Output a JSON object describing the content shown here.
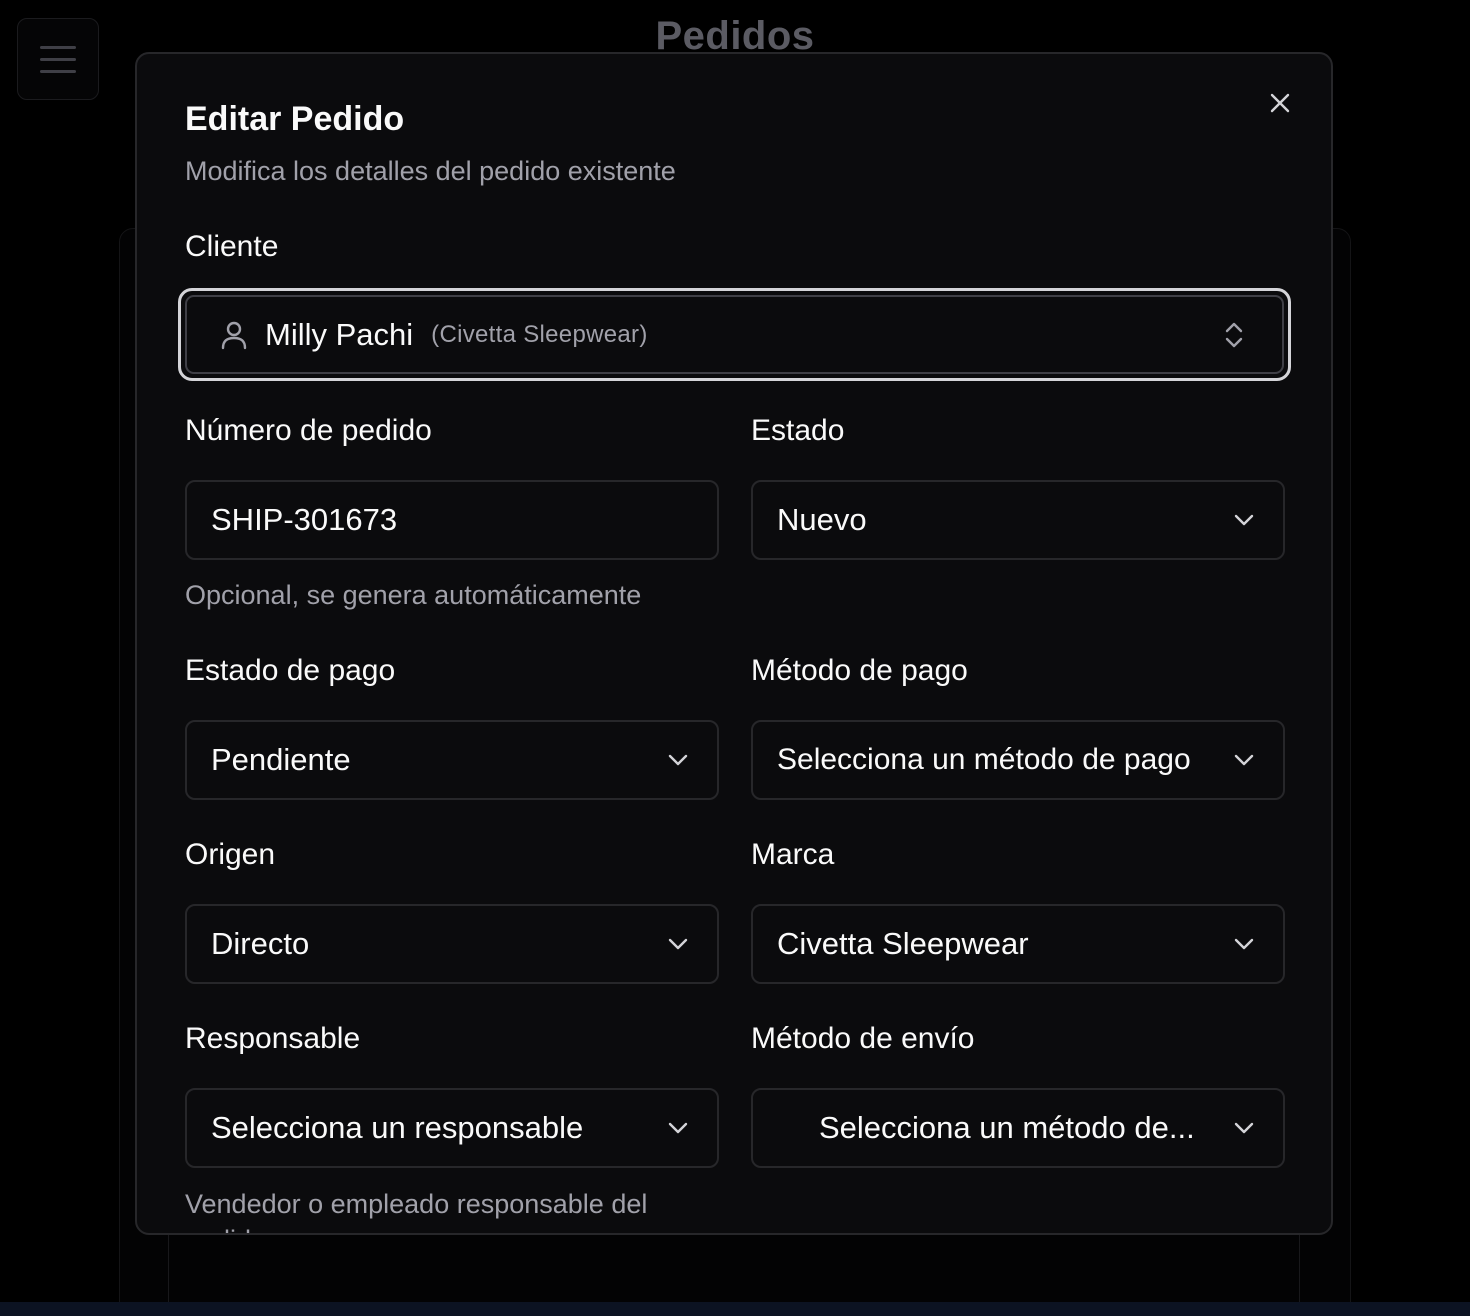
{
  "background": {
    "page_title": "Pedidos"
  },
  "modal": {
    "title": "Editar Pedido",
    "description": "Modifica los detalles del pedido existente",
    "close_icon": "close-icon",
    "cliente": {
      "label": "Cliente",
      "name": "Milly Pachi",
      "brand": "(Civetta Sleepwear)",
      "icon": "user-icon"
    },
    "numero_pedido": {
      "label": "Número de pedido",
      "value": "SHIP-301673",
      "hint": "Opcional, se genera automáticamente"
    },
    "estado": {
      "label": "Estado",
      "value": "Nuevo"
    },
    "estado_pago": {
      "label": "Estado de pago",
      "value": "Pendiente"
    },
    "metodo_pago": {
      "label": "Método de pago",
      "value": "Selecciona un método de pago"
    },
    "origen": {
      "label": "Origen",
      "value": "Directo"
    },
    "marca": {
      "label": "Marca",
      "value": "Civetta Sleepwear"
    },
    "responsable": {
      "label": "Responsable",
      "value": "Selecciona un responsable",
      "hint": "Vendedor o empleado responsable del pedido"
    },
    "metodo_envio": {
      "label": "Método de envío",
      "value": "Selecciona un método de..."
    }
  },
  "colors": {
    "background": "#000000",
    "modal_bg": "#0b0b0d",
    "border": "#27272a",
    "focus_ring": "#d4d4d8",
    "text": "#fafafa",
    "muted": "#a1a1aa"
  }
}
